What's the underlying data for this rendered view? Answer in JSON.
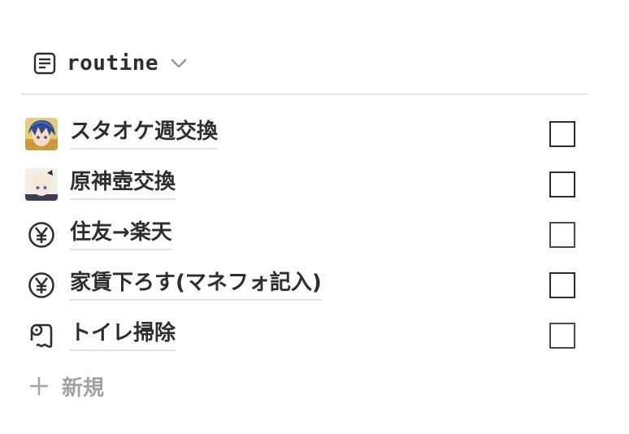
{
  "header": {
    "title": "routine",
    "icon": "document-icon",
    "chevron": "chevron-down-icon"
  },
  "items": [
    {
      "label": "スタオケ週交換",
      "icon": "anime-avatar-blue-hair",
      "checked": false
    },
    {
      "label": "原神壺交換",
      "icon": "anime-avatar-white-hair",
      "checked": false
    },
    {
      "label": "住友→楽天",
      "icon": "yen-coin-icon",
      "checked": false
    },
    {
      "label": "家賃下ろす(マネフォ記入)",
      "icon": "yen-coin-icon",
      "checked": false
    },
    {
      "label": "トイレ掃除",
      "icon": "toilet-paper-icon",
      "checked": false
    }
  ],
  "new_item": {
    "label": "新規",
    "icon": "plus-icon"
  },
  "colors": {
    "text": "#2f2e2a",
    "muted": "#a3a29e",
    "divider": "#e7e7e5"
  }
}
